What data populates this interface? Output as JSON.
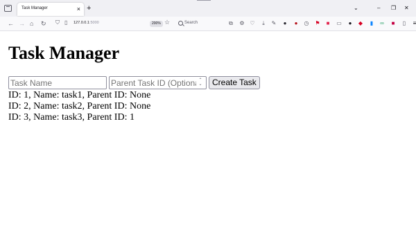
{
  "browser": {
    "tab_title": "Task Manager",
    "tab_close": "×",
    "new_tab": "+",
    "url_host": "127.0.0.1",
    "url_port": ":5000",
    "zoom": "200%",
    "search_placeholder": "Search",
    "window_controls": {
      "list": "⌄",
      "minimize": "–",
      "restore": "❐",
      "close": "✕"
    },
    "nav": {
      "back": "←",
      "forward": "→",
      "home": "⌂",
      "reload": "↻"
    },
    "icons": {
      "tab_list": "tab-list-icon",
      "shield": "shield-icon",
      "page": "page-icon",
      "star": "star-icon",
      "search": "search-icon"
    },
    "extensions": [
      {
        "name": "reader-view-icon",
        "glyph": "⧉",
        "color": "#5b5b66"
      },
      {
        "name": "settings-icon",
        "glyph": "⚙",
        "color": "#5b5b66"
      },
      {
        "name": "pocket-icon",
        "glyph": "♡",
        "color": "#5b5b66"
      },
      {
        "name": "download-icon",
        "glyph": "⤓",
        "color": "#5b5b66"
      },
      {
        "name": "tools-icon",
        "glyph": "✎",
        "color": "#5b5b66"
      },
      {
        "name": "extension-dark-icon",
        "glyph": "●",
        "color": "#2b2a33"
      },
      {
        "name": "ublock-icon",
        "glyph": "●",
        "color": "#b5121b"
      },
      {
        "name": "clock-icon",
        "glyph": "◷",
        "color": "#5b5b66"
      },
      {
        "name": "flag-icon",
        "glyph": "⚑",
        "color": "#d70022"
      },
      {
        "name": "record-icon",
        "glyph": "■",
        "color": "#e22850"
      },
      {
        "name": "screen-icon",
        "glyph": "▭",
        "color": "#5b5b66"
      },
      {
        "name": "dark-circle-icon",
        "glyph": "●",
        "color": "#1c1b22"
      },
      {
        "name": "color-icon",
        "glyph": "◆",
        "color": "#d70022"
      },
      {
        "name": "bookmark-icon",
        "glyph": "▮",
        "color": "#0a84ff"
      },
      {
        "name": "link-icon",
        "glyph": "∞",
        "color": "#30a46c"
      },
      {
        "name": "red-ext-icon",
        "glyph": "■",
        "color": "#c50042"
      },
      {
        "name": "doc-icon",
        "glyph": "▯",
        "color": "#5b5b66"
      },
      {
        "name": "menu-icon",
        "glyph": "≡",
        "color": "#15141a"
      }
    ]
  },
  "page": {
    "title": "Task Manager",
    "form": {
      "task_name_placeholder": "Task Name",
      "parent_id_placeholder": "Parent Task ID (Optional)",
      "spinner_up": "⌃",
      "spinner_down": "⌄",
      "create_button": "Create Task"
    },
    "tasks": [
      {
        "text": "ID: 1, Name: task1, Parent ID: None"
      },
      {
        "text": "ID: 2, Name: task2, Parent ID: None"
      },
      {
        "text": "ID: 3, Name: task3, Parent ID: 1"
      }
    ]
  }
}
